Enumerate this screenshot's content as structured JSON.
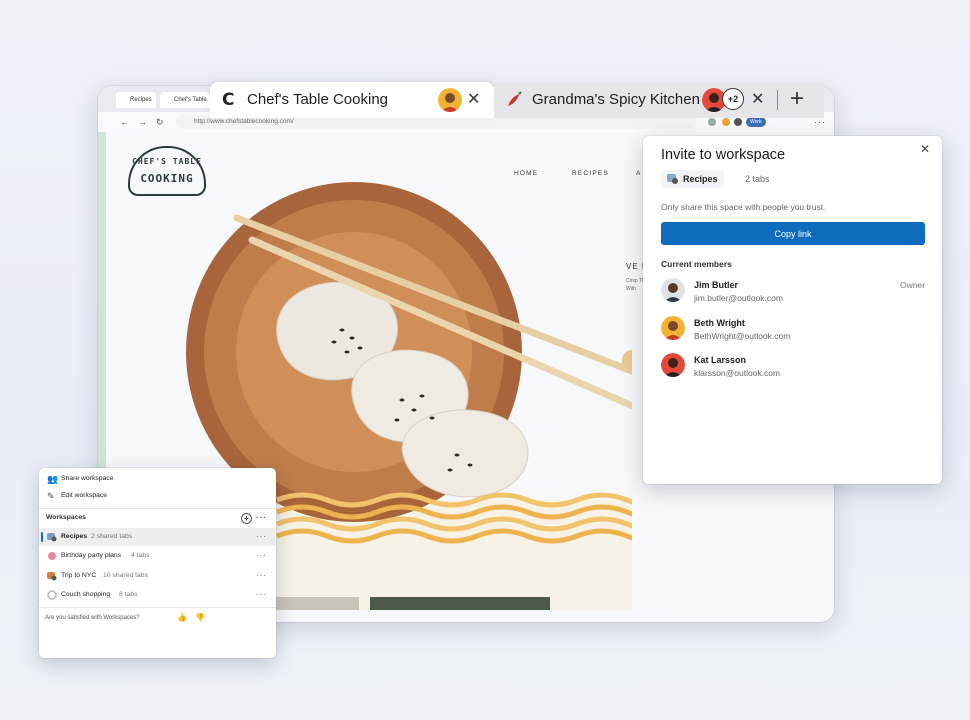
{
  "browser": {
    "mini_tabs": [
      "Recipes",
      "Chef's Table"
    ],
    "address_url": "http://www.chefstablecooking.com/",
    "profile_label": "Work"
  },
  "tabs": [
    {
      "title": "Chef's Table Cooking",
      "favicon": "C"
    },
    {
      "title": "Grandma's Spicy Kitchen",
      "extra_count": "+2"
    }
  ],
  "site": {
    "logo_line1": "CHEF'S TABLE",
    "logo_line2": "COOKING",
    "nav": [
      "HOME",
      "RECIPES",
      "A"
    ],
    "hero_heading": "VE PO",
    "hero_body": "Crisp These take With"
  },
  "invite": {
    "title": "Invite to workspace",
    "workspace_name": "Recipes",
    "tab_count": "2 tabs",
    "trust_note": "Only share this space with people you trust.",
    "copy_link_label": "Copy link",
    "members_title": "Current members",
    "members": [
      {
        "name": "Jim Butler",
        "email": "jim.butler@outlook.com",
        "role": "Owner"
      },
      {
        "name": "Beth Wright",
        "email": "BethWright@outlook.com",
        "role": ""
      },
      {
        "name": "Kat Larsson",
        "email": "klarsson@outlook.com",
        "role": ""
      }
    ]
  },
  "workspaces_panel": {
    "share_label": "Share workspace",
    "edit_label": "Edit workspace",
    "section_title": "Workspaces",
    "items": [
      {
        "name": "Recipes",
        "count": "2 shared tabs",
        "color": "#7a9cc6"
      },
      {
        "name": "Birthday party plans",
        "count": "4 tabs",
        "color": "#e58aa0"
      },
      {
        "name": "Trip to NYC",
        "count": "10 shared tabs",
        "color": "#d9813b"
      },
      {
        "name": "Couch shopping",
        "count": "8 tabs",
        "color": "#b9b9b9"
      }
    ],
    "feedback_prompt": "Are you satisfied with Workspaces?"
  },
  "colors": {
    "accent": "#0f6cbd"
  }
}
